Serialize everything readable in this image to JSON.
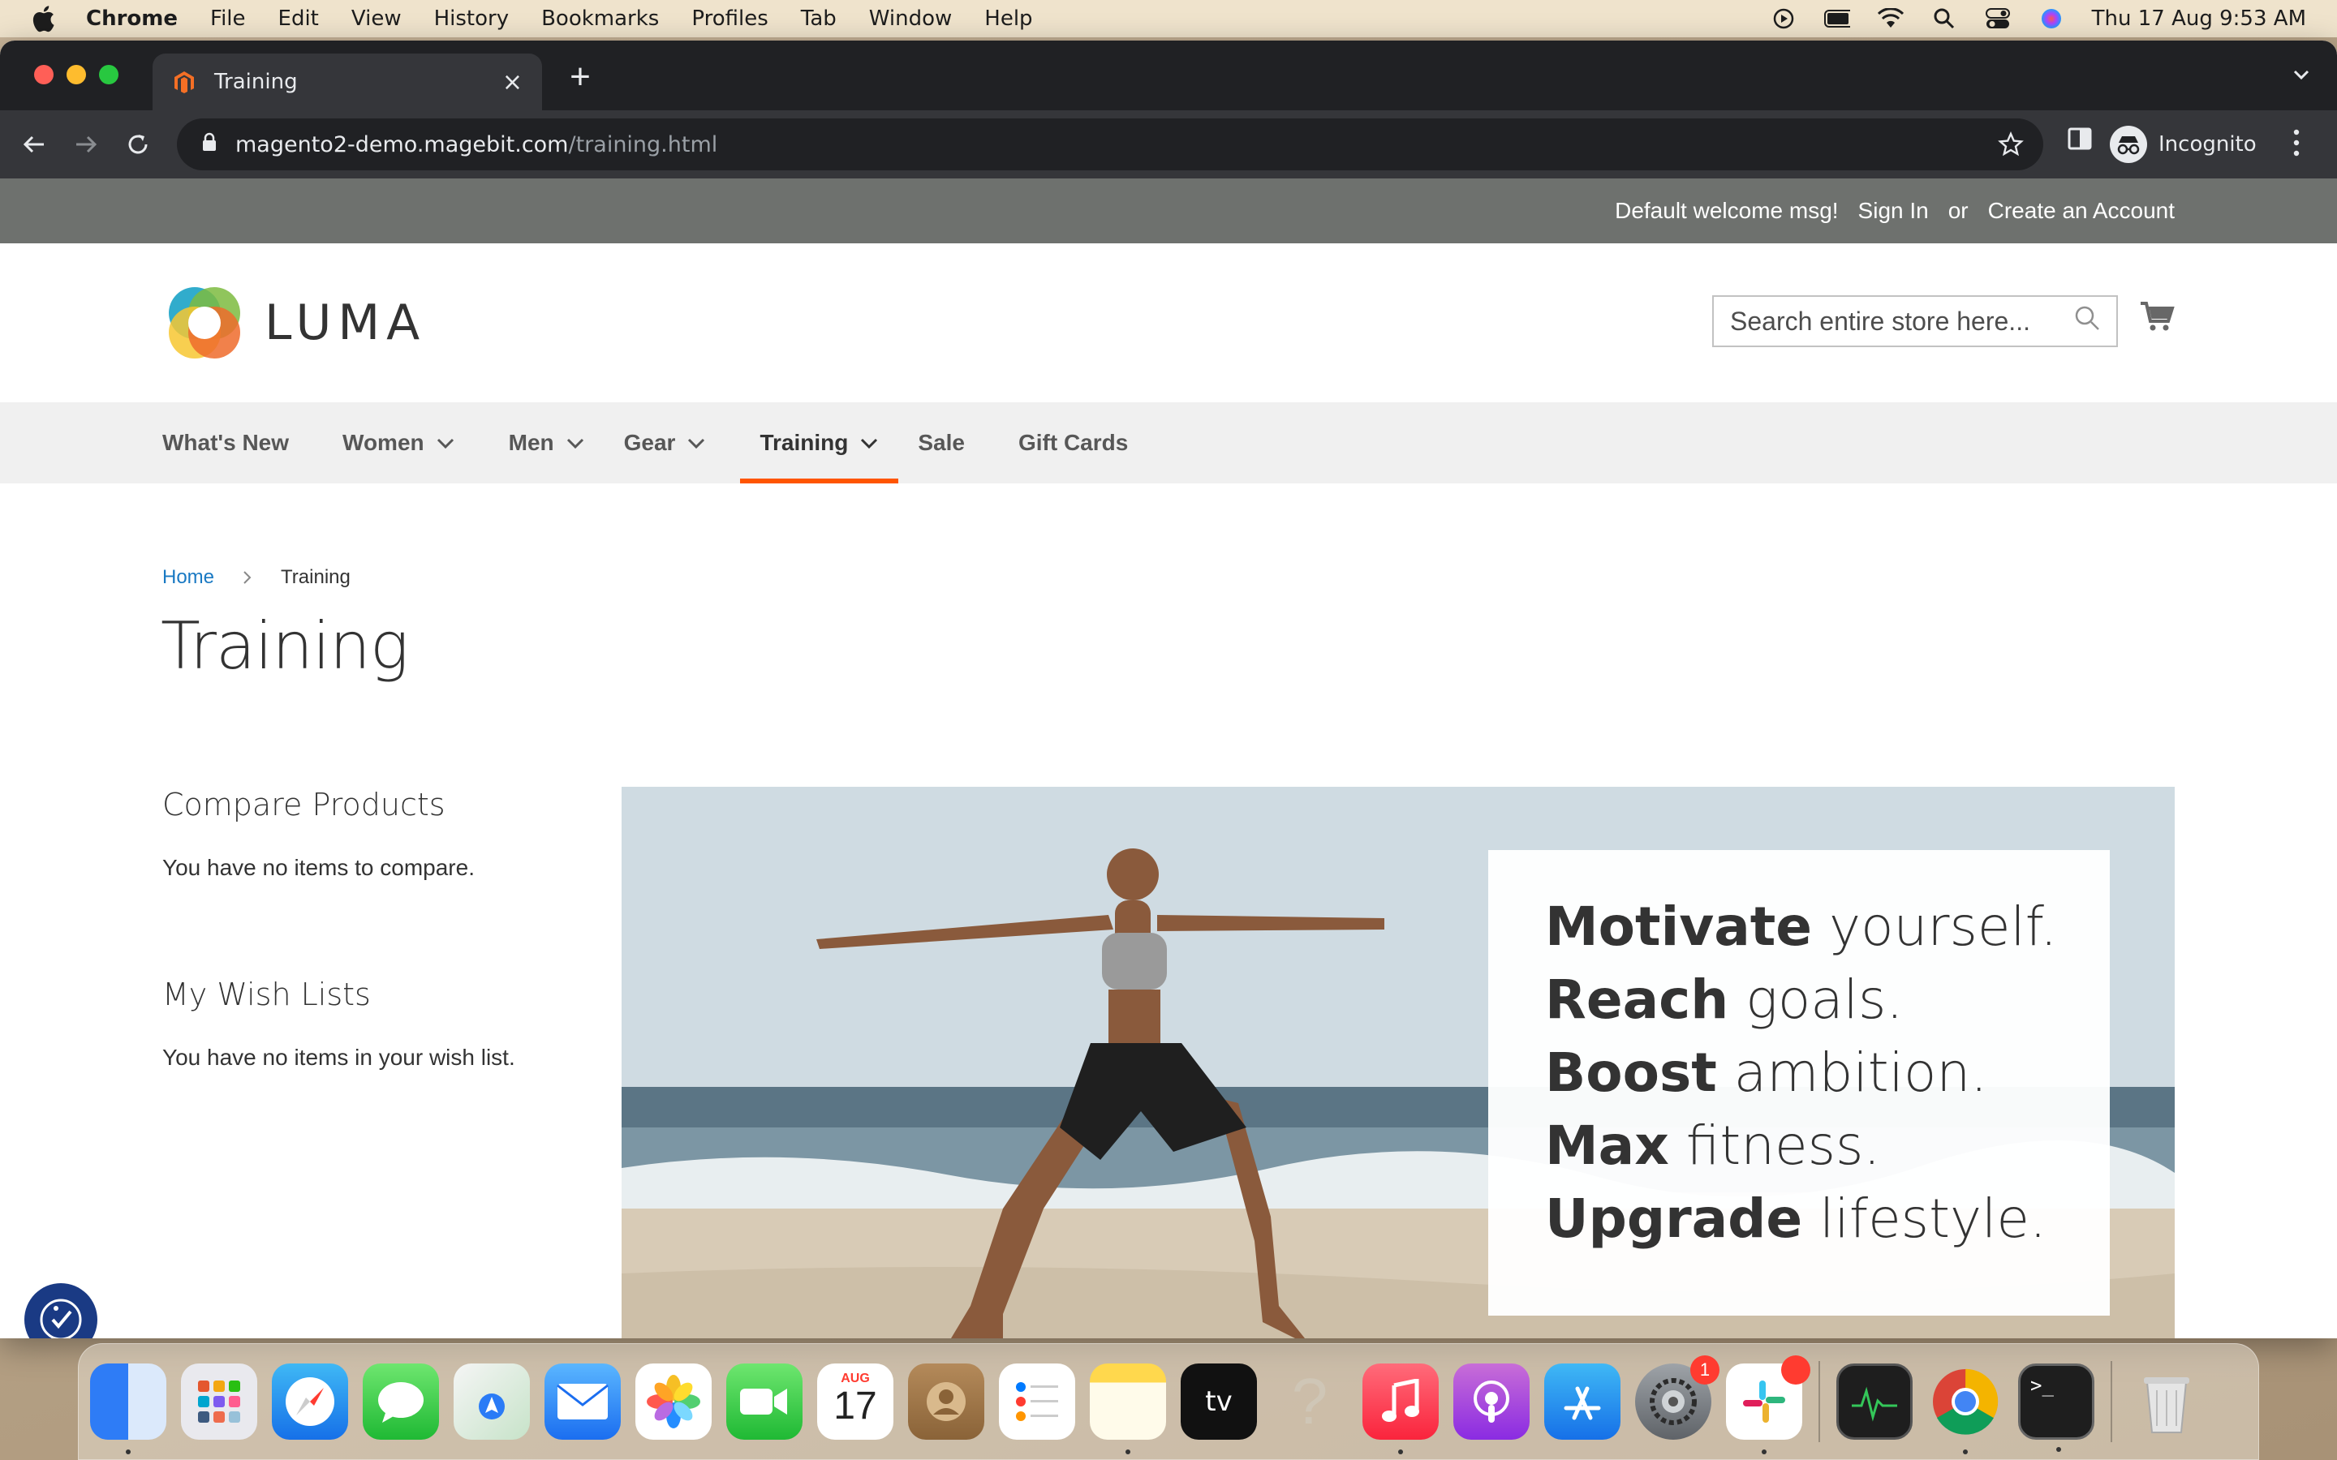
{
  "menubar": {
    "app": "Chrome",
    "items": [
      "File",
      "Edit",
      "View",
      "History",
      "Bookmarks",
      "Profiles",
      "Tab",
      "Window",
      "Help"
    ],
    "clock": "Thu 17 Aug  9:53 AM"
  },
  "browser": {
    "tab_title": "Training",
    "url_host": "magento2-demo.magebit.com",
    "url_path": "/training.html",
    "profile_label": "Incognito"
  },
  "store": {
    "welcome": "Default welcome msg!",
    "sign_in": "Sign In",
    "or": "or",
    "create_account": "Create an Account",
    "logo_text": "LUMA",
    "search_placeholder": "Search entire store here...",
    "nav": [
      {
        "label": "What's New"
      },
      {
        "label": "Women"
      },
      {
        "label": "Men"
      },
      {
        "label": "Gear"
      },
      {
        "label": "Training"
      },
      {
        "label": "Sale"
      },
      {
        "label": "Gift Cards"
      }
    ],
    "breadcrumb_home": "Home",
    "breadcrumb_current": "Training",
    "page_title": "Training",
    "compare_title": "Compare Products",
    "compare_text": "You have no items to compare.",
    "wishlist_title": "My Wish Lists",
    "wishlist_text": "You have no items in your wish list.",
    "promo": [
      {
        "bold": "Motivate",
        "rest": " yourself."
      },
      {
        "bold": "Reach",
        "rest": " goals."
      },
      {
        "bold": "Boost",
        "rest": " ambition."
      },
      {
        "bold": "Max",
        "rest": " fitness."
      },
      {
        "bold": "Upgrade",
        "rest": " lifestyle."
      }
    ]
  },
  "dock": {
    "calendar_month": "AUG",
    "calendar_day": "17",
    "settings_badge": "1"
  },
  "colors": {
    "accent": "#ff5501",
    "link": "#1979c3",
    "panel_header": "#6e716e"
  }
}
